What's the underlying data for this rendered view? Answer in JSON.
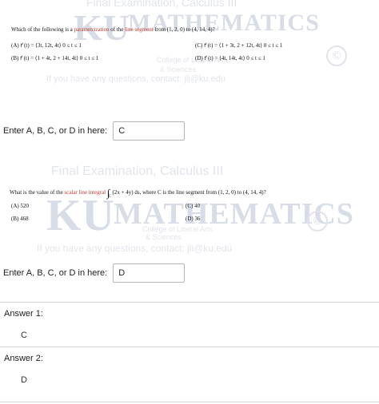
{
  "q1": {
    "watermark_title": "Final Examination, Calculus III",
    "watermark_logo": "KU",
    "watermark_dept": "MATHEMATICS",
    "watermark_college": "College of Liberal Arts",
    "watermark_sciences": "& Sciences",
    "watermark_contact": "If you have any questions, contact: jli@ku.edu",
    "question_prefix": "Which of the following is a ",
    "question_term1": "parametrization",
    "question_mid": " of the ",
    "question_term2": "line segment",
    "question_suffix": " from (1, 2, 0) to (4, 14, 4)?",
    "choices": [
      "(A)  r⃗ (t) = ⟨3t, 12t, 4t⟩   0 ≤ t ≤ 1",
      "(C)  r⃗ (t) = ⟨1 + 3t, 2 + 12t, 4t⟩   0 ≤ t ≤ 1",
      "(B)  r⃗ (t) = ⟨1 + 4t, 2 + 14t, 4t⟩   0 ≤ t ≤ 1",
      "(D)  r⃗ (t) = ⟨4t, 14t, 4t⟩   0 ≤ t ≤ 1"
    ]
  },
  "q1_answer": {
    "label": "Enter A, B, C, or D in here:",
    "value": "C"
  },
  "q2": {
    "watermark_title": "Final Examination, Calculus III",
    "watermark_logo": "KU",
    "watermark_dept": "MATHEMATICS",
    "watermark_college": "College of Liberal Arts",
    "watermark_sciences": "& Sciences",
    "watermark_contact": "If you have any questions, contact: jli@ku.edu",
    "question_prefix": "What is the value of the ",
    "question_term": "scalar line integral",
    "integral_sign": "∫",
    "integral_sub": "C",
    "integrand": "(2x + 4y) ds",
    "question_suffix": ", where C is the line segment from (1, 2, 0) to (4, 14, 4)?",
    "choices": [
      "(A)  520",
      "(C)  40",
      "(B)  468",
      "(D)  36"
    ]
  },
  "q2_answer": {
    "label": "Enter A, B, C, or D in here:",
    "value": "D"
  },
  "answers": [
    {
      "title": "Answer 1:",
      "value": "C"
    },
    {
      "title": "Answer 2:",
      "value": "D"
    }
  ],
  "colors": {
    "term_highlight": "#c0392b",
    "watermark": "#d7dce6"
  },
  "icons": [
    "copyright-icon"
  ]
}
